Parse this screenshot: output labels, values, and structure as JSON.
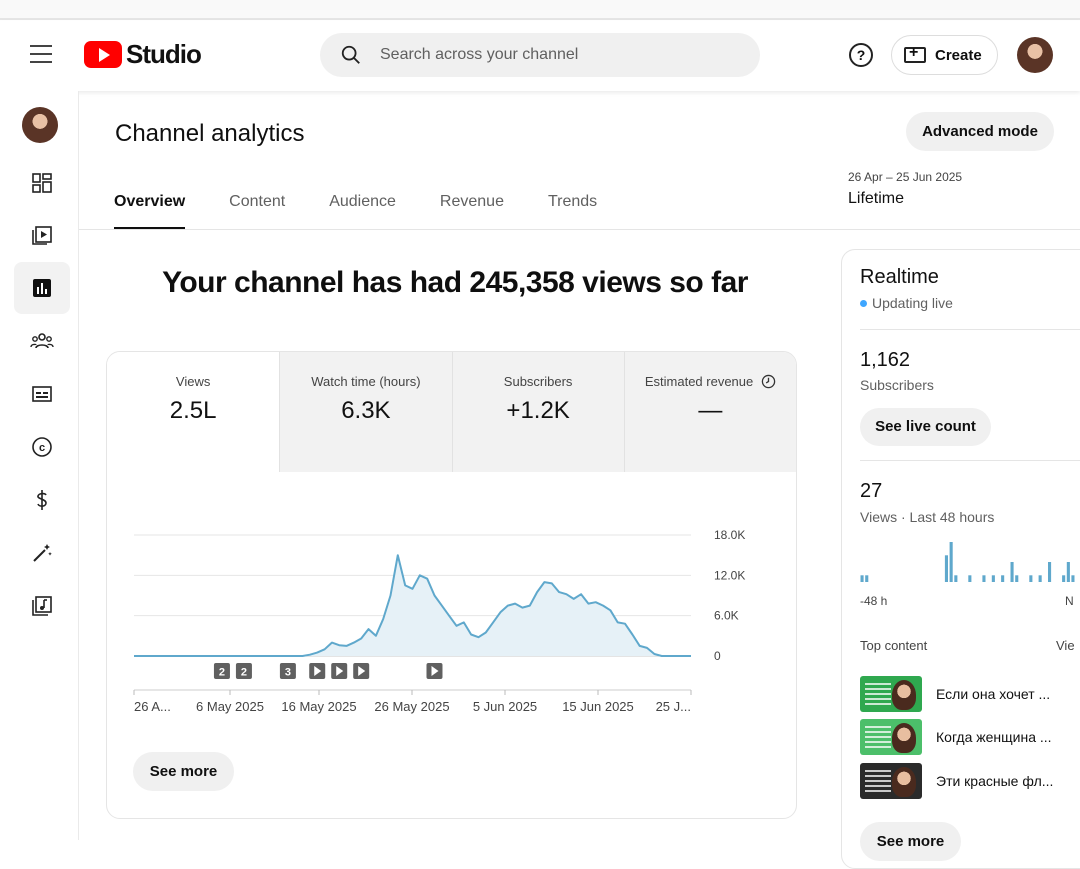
{
  "header": {
    "logo_text": "Studio",
    "search_placeholder": "Search across your channel",
    "help_label": "?",
    "create_label": "Create"
  },
  "page": {
    "title": "Channel analytics",
    "advanced_mode": "Advanced mode",
    "date_range": "26 Apr – 25 Jun 2025",
    "period": "Lifetime",
    "tabs": [
      "Overview",
      "Content",
      "Audience",
      "Revenue",
      "Trends"
    ],
    "active_tab": "Overview",
    "headline": "Your channel has had 245,358 views so far",
    "see_more": "See more"
  },
  "metrics": [
    {
      "label": "Views",
      "value": "2.5L"
    },
    {
      "label": "Watch time (hours)",
      "value": "6.3K"
    },
    {
      "label": "Subscribers",
      "value": "+1.2K"
    },
    {
      "label": "Estimated revenue",
      "value": "—"
    }
  ],
  "chart_data": {
    "type": "area",
    "series": [
      {
        "values": [
          0,
          0,
          0,
          0,
          0,
          0,
          0,
          0,
          0,
          0,
          0,
          0,
          0,
          0,
          0,
          0,
          0,
          0,
          0,
          0,
          0,
          0,
          0,
          0,
          200,
          500,
          1000,
          2000,
          1600,
          1500,
          2000,
          2600,
          4000,
          3000,
          5500,
          9000,
          15000,
          10500,
          10000,
          12000,
          11500,
          9000,
          7500,
          6000,
          4500,
          5000,
          3200,
          2800,
          3500,
          5000,
          6500,
          7500,
          7800,
          7200,
          7500,
          9500,
          11000,
          10800,
          9500,
          9200,
          8500,
          9200,
          7800,
          8000,
          7500,
          6800,
          5000,
          4800,
          3200,
          1500,
          1200,
          300,
          0,
          0,
          0,
          0,
          0
        ]
      }
    ],
    "x_labels": [
      "26 A...",
      "6 May 2025",
      "16 May 2025",
      "26 May 2025",
      "5 Jun 2025",
      "15 Jun 2025",
      "25 J..."
    ],
    "ylim": [
      0,
      18000
    ],
    "y_ticks": [
      "18.0K",
      "12.0K",
      "6.0K",
      "0"
    ],
    "markers": [
      {
        "label": "2",
        "kind": "number",
        "day": 12
      },
      {
        "label": "2",
        "kind": "number",
        "day": 15
      },
      {
        "label": "3",
        "kind": "number",
        "day": 21
      },
      {
        "label": "",
        "kind": "video",
        "day": 25
      },
      {
        "label": "",
        "kind": "video",
        "day": 28
      },
      {
        "label": "",
        "kind": "video",
        "day": 31
      },
      {
        "label": "",
        "kind": "video",
        "day": 41
      }
    ]
  },
  "realtime": {
    "title": "Realtime",
    "status": "Updating live",
    "subscribers_value": "1,162",
    "subscribers_label": "Subscribers",
    "see_live_count": "See live count",
    "views_value": "27",
    "views_label": "Views · Last 48 hours",
    "axis_left": "-48 h",
    "axis_right": "N",
    "top_content_label": "Top content",
    "views_col": "Vie",
    "bars": [
      1,
      1,
      0,
      0,
      0,
      0,
      0,
      0,
      0,
      0,
      0,
      0,
      0,
      0,
      0,
      0,
      0,
      0,
      4,
      6,
      1,
      0,
      0,
      1,
      0,
      0,
      1,
      0,
      1,
      0,
      1,
      0,
      3,
      1,
      0,
      0,
      1,
      0,
      1,
      0,
      3,
      0,
      0,
      1,
      3,
      1,
      0,
      3
    ],
    "items": [
      {
        "title": "Если она хочет ...",
        "thumb_color": "#2fa84f"
      },
      {
        "title": "Когда женщина ...",
        "thumb_color": "#4cbf6a"
      },
      {
        "title": "Эти красные фл...",
        "thumb_color": "#2b2b2b"
      }
    ],
    "see_more": "See more"
  }
}
